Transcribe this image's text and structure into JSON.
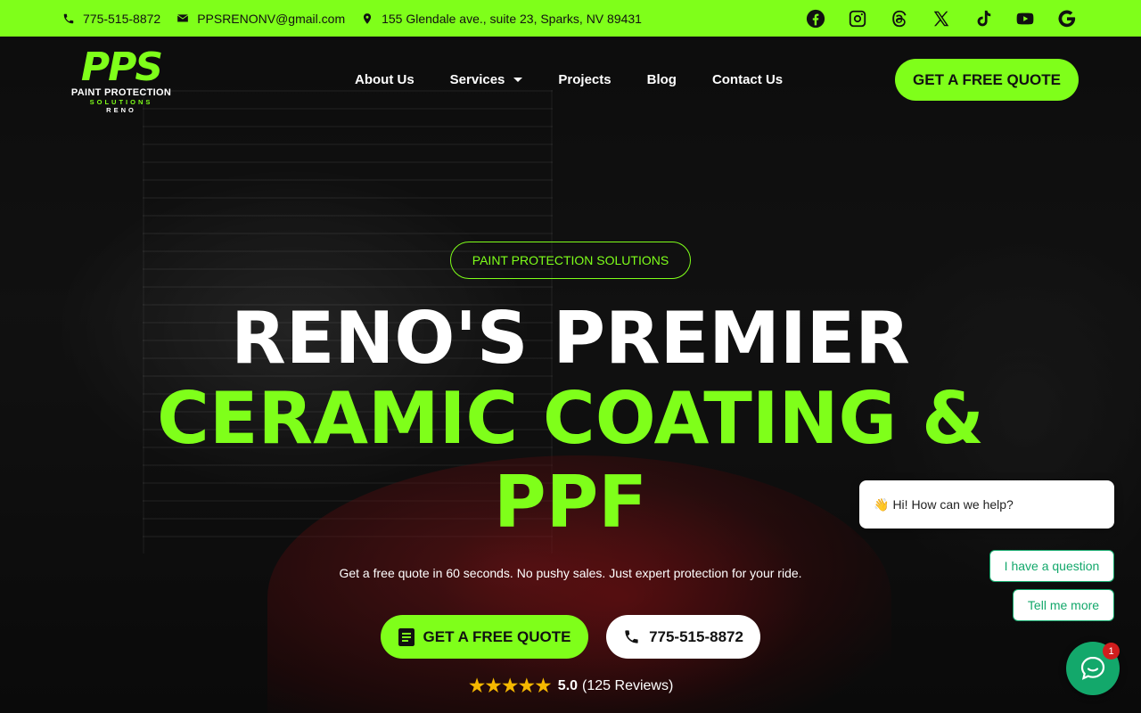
{
  "topbar": {
    "phone": "775-515-8872",
    "email": "PPSRENONV@gmail.com",
    "address": "155 Glendale ave., suite 23, Sparks, NV 89431",
    "socials": [
      "facebook-icon",
      "instagram-icon",
      "threads-icon",
      "x-icon",
      "tiktok-icon",
      "youtube-icon",
      "google-icon"
    ]
  },
  "logo": {
    "mark": "PPS",
    "line1": "PAINT PROTECTION",
    "line2": "SOLUTIONS",
    "line3": "RENO"
  },
  "nav": {
    "items": [
      "About Us",
      "Services",
      "Projects",
      "Blog",
      "Contact Us"
    ],
    "cta": "GET A FREE QUOTE"
  },
  "hero": {
    "badge": "PAINT PROTECTION SOLUTIONS",
    "headline_line1": "RENO'S PREMIER",
    "headline_line2": "CERAMIC COATING &",
    "headline_line3": "PPF",
    "subtitle": "Get a free quote in 60 seconds. No pushy sales. Just expert protection for your ride.",
    "quote_button": "GET A FREE QUOTE",
    "phone_button": "775-515-8872",
    "stars": "★★★★★",
    "rating_value": "5.0",
    "rating_count": "(125 Reviews)"
  },
  "chat": {
    "greeting_emoji": "👋",
    "greeting": "Hi! How can we help?",
    "option1": "I have a question",
    "option2": "Tell me more",
    "unread_count": "1"
  },
  "colors": {
    "accent": "#7fff1a",
    "chat_green": "#13a86b",
    "badge_red": "#d11d1d",
    "star": "#f5b800"
  }
}
